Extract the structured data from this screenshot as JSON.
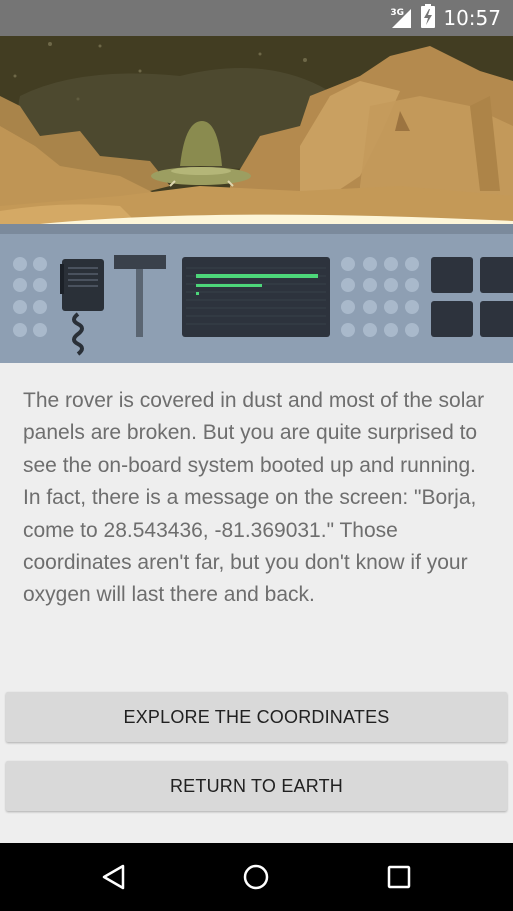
{
  "status_bar": {
    "network_type": "3G",
    "time": "10:57",
    "icons": [
      "cell-signal-icon",
      "battery-charging-icon"
    ]
  },
  "scene": {
    "description_icon": "mars-rover-console-illustration",
    "colors": {
      "sky": "#423d22",
      "rock": "#c79a57",
      "panel": "#8e9fb3",
      "screen": "#2d333d",
      "screen_line": "#4dd67a"
    }
  },
  "story": {
    "text": "The rover is covered in dust and most of the solar panels are broken. But you are quite surprised to see the on-board system booted up and running. In fact, there is a message on the screen: \"Borja, come to 28.543436, -81.369031.\" Those coordinates aren't far, but you don't know if your oxygen will last there and back."
  },
  "choices": {
    "explore_label": "EXPLORE THE COORDINATES",
    "return_label": "RETURN TO EARTH"
  },
  "nav_bar": {
    "back": "back-icon",
    "home": "home-icon",
    "recents": "recents-icon"
  }
}
